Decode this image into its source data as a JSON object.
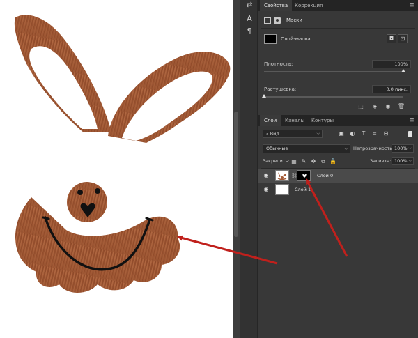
{
  "properties_panel": {
    "tabs": [
      {
        "label": "Свойства",
        "active": true
      },
      {
        "label": "Коррекция",
        "active": false
      }
    ],
    "section_title": "Маски",
    "mask_label": "Слой-маска",
    "density": {
      "label": "Плотность:",
      "value": "100%",
      "fraction": 1.0
    },
    "feather": {
      "label": "Растушевка:",
      "value": "0,0 пикс.",
      "fraction": 0.0
    },
    "bottom_tools": [
      "selection-from-mask-icon",
      "apply-mask-icon",
      "toggle-mask-icon",
      "delete-mask-icon"
    ]
  },
  "layers_panel": {
    "tabs": [
      {
        "label": "Слои",
        "active": true
      },
      {
        "label": "Каналы",
        "active": false
      },
      {
        "label": "Контуры",
        "active": false
      }
    ],
    "filter": {
      "label": "Вид"
    },
    "blend_mode": "Обычные",
    "opacity": {
      "label": "Непрозрачность:",
      "value": "100%"
    },
    "lock": {
      "label": "Закрепить:"
    },
    "fill": {
      "label": "Заливка:",
      "value": "100%"
    },
    "layers": [
      {
        "name": "Слой 0",
        "visible": true,
        "selected": true,
        "has_mask": true
      },
      {
        "name": "Слой 1",
        "visible": true,
        "selected": false,
        "has_mask": false
      }
    ]
  },
  "toolstrip": {
    "tools": [
      "swap-icon",
      "text-tool-icon",
      "paragraph-icon"
    ]
  },
  "colors": {
    "panel_bg": "#383838",
    "tabbar_bg": "#242424",
    "wood": "#a35a36",
    "arrow": "#c0201c"
  }
}
